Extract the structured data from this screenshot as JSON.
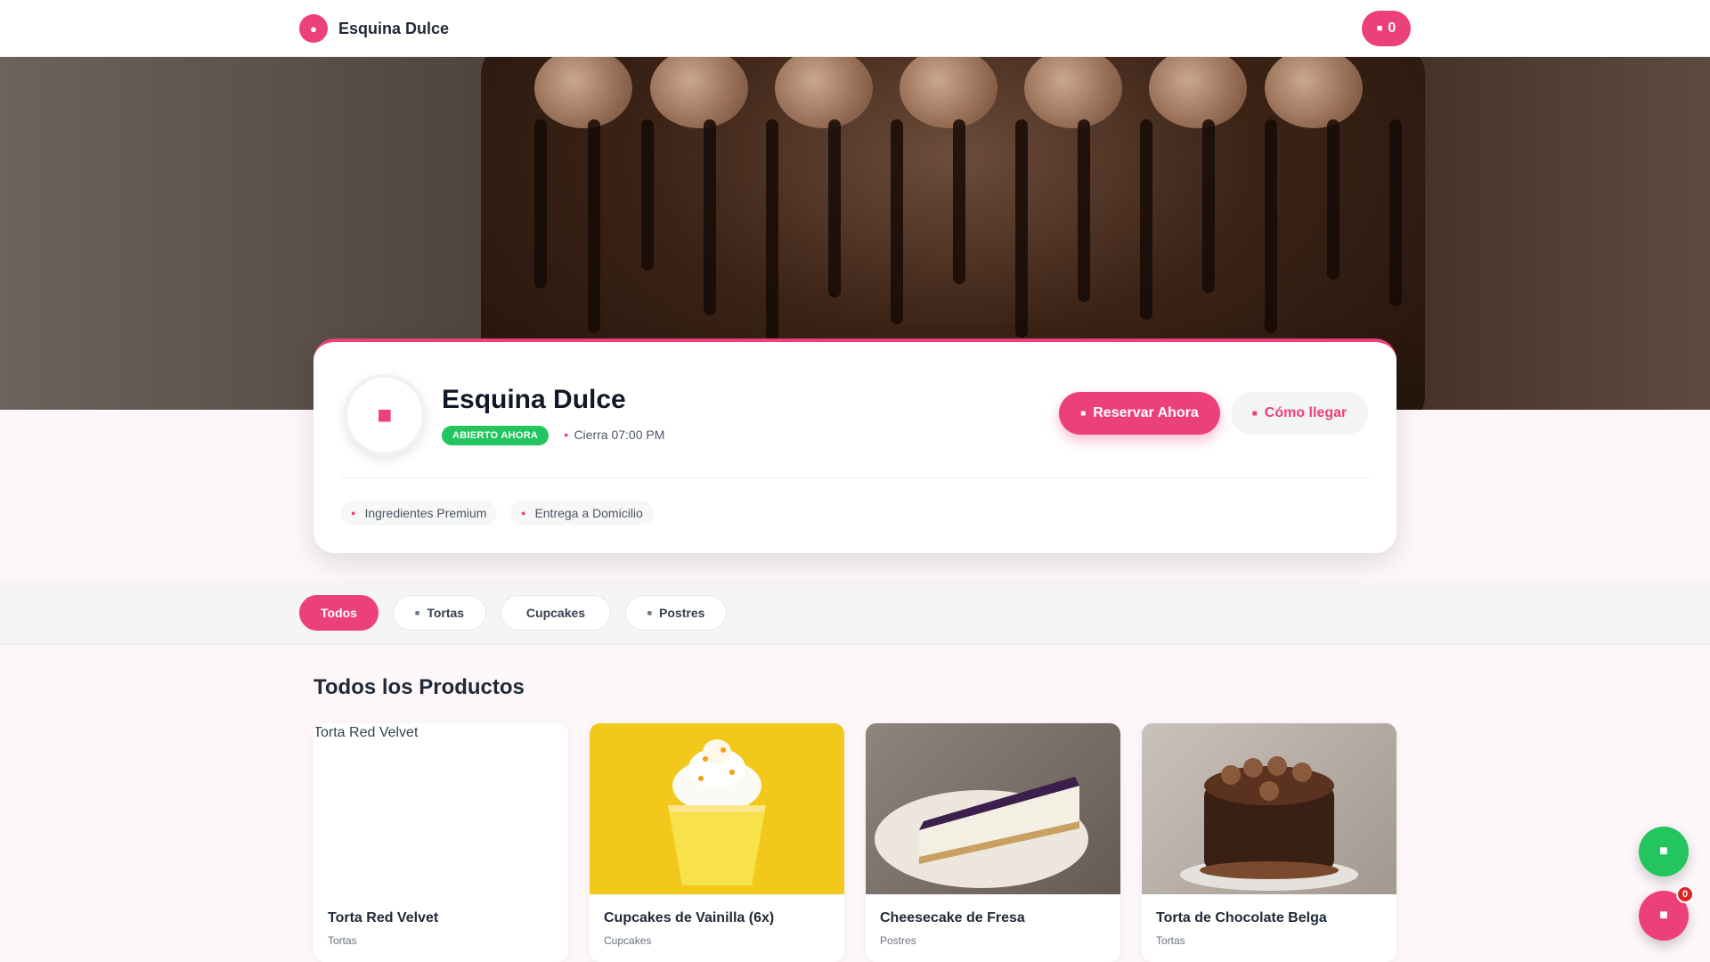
{
  "header": {
    "brand_name": "Esquina Dulce",
    "brand_icon": "cake-icon",
    "cart_count": "0",
    "cart_icon": "shopping-bag-icon"
  },
  "hero": {
    "image_alt": "Chocolate drip cake"
  },
  "info": {
    "title": "Esquina Dulce",
    "status": "ABIERTO AHORA",
    "status_color": "#22c55e",
    "close_time": "Cierra 07:00 PM",
    "reserve_label": "Reservar Ahora",
    "directions_label": "Cómo llegar",
    "features": [
      "Ingredientes Premium",
      "Entrega a Domicilio"
    ]
  },
  "categories": [
    "Todos",
    "Tortas",
    "Cupcakes",
    "Postres"
  ],
  "active_category": "Todos",
  "products_section": {
    "title": "Todos los Productos",
    "items": [
      {
        "name": "Torta Red Velvet",
        "category": "Tortas",
        "image_alt": "Torta Red Velvet"
      },
      {
        "name": "Cupcakes de Vainilla (6x)",
        "category": "Cupcakes"
      },
      {
        "name": "Cheesecake de Fresa",
        "category": "Postres"
      },
      {
        "name": "Torta de Chocolate Belga",
        "category": "Tortas"
      }
    ]
  },
  "floating": {
    "whatsapp_icon": "whatsapp-icon",
    "cart_icon": "shopping-bag-icon",
    "cart_badge": "0"
  },
  "colors": {
    "accent": "#ec407a",
    "success": "#22c55e",
    "badge_red": "#dc2626"
  }
}
